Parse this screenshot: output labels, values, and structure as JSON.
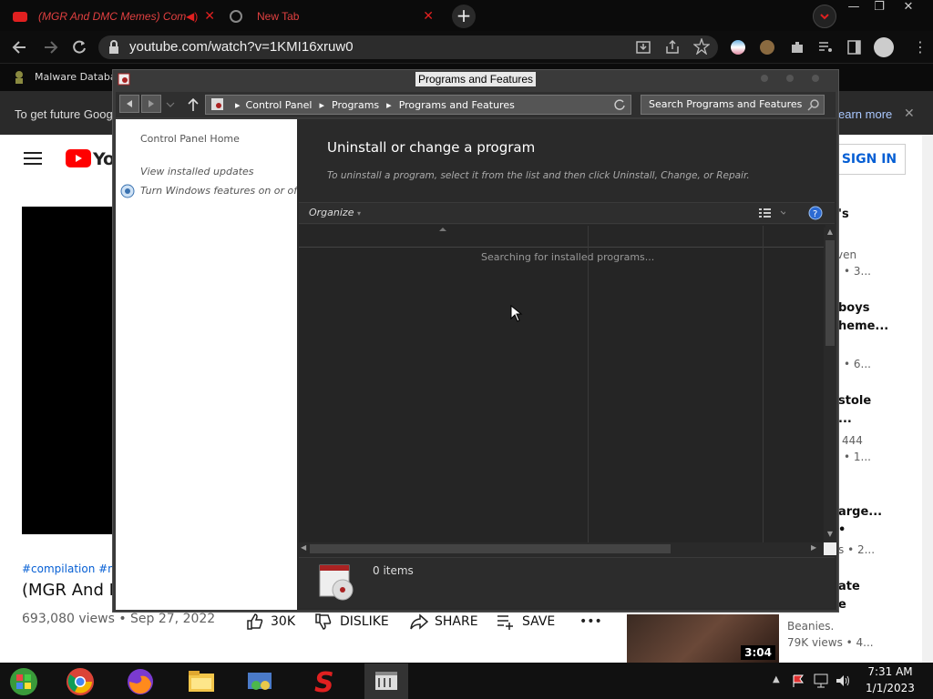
{
  "browser": {
    "tab1_title": "(MGR And DMC Memes) Com",
    "tab2_title": "New Tab",
    "url": "youtube.com/watch?v=1KMI16xruw0",
    "bookmark": "Malware Databa",
    "infobar_text": "To get future Goog",
    "infobar_learn": "earn more",
    "min": "—",
    "max": "❐",
    "close": "✕"
  },
  "youtube": {
    "logo": "Yo",
    "sign_in": "SIGN IN",
    "tags": "#compilation #me",
    "video_title": "(MGR And D",
    "views": "693,080 views • Sep 27, 2022",
    "likes": "30K",
    "dislike": "DISLIKE",
    "share": "SHARE",
    "save": "SAVE",
    "more": "•••",
    "side": [
      {
        "title": "'s",
        "sub": "ven",
        "sub2": "• 3..."
      },
      {
        "title": "boys",
        "title2": "heme...",
        "sub": "• 6..."
      },
      {
        "title": "stole",
        "title2": "...",
        "sub": "444",
        "sub2": "• 1..."
      },
      {
        "title": "arge...",
        "title2": "•",
        "sub": "s • 2..."
      },
      {
        "title": "ate",
        "title2": "e",
        "sub": "Beanies.",
        "sub2": "79K views • 4..."
      }
    ],
    "duration": "3:04"
  },
  "window": {
    "title": "Programs and Features",
    "breadcrumb": [
      "Control Panel",
      "Programs",
      "Programs and Features"
    ],
    "search_placeholder": "Search Programs and Features",
    "left_links": [
      "Control Panel Home",
      "View installed updates",
      "Turn Windows features on or off"
    ],
    "heading": "Uninstall or change a program",
    "description": "To uninstall a program, select it from the list and then click Uninstall, Change, or Repair.",
    "organize": "Organize",
    "searching": "Searching for installed programs...",
    "item_count": "0 items"
  },
  "taskbar": {
    "time": "7:31 AM",
    "date": "1/1/2023"
  }
}
